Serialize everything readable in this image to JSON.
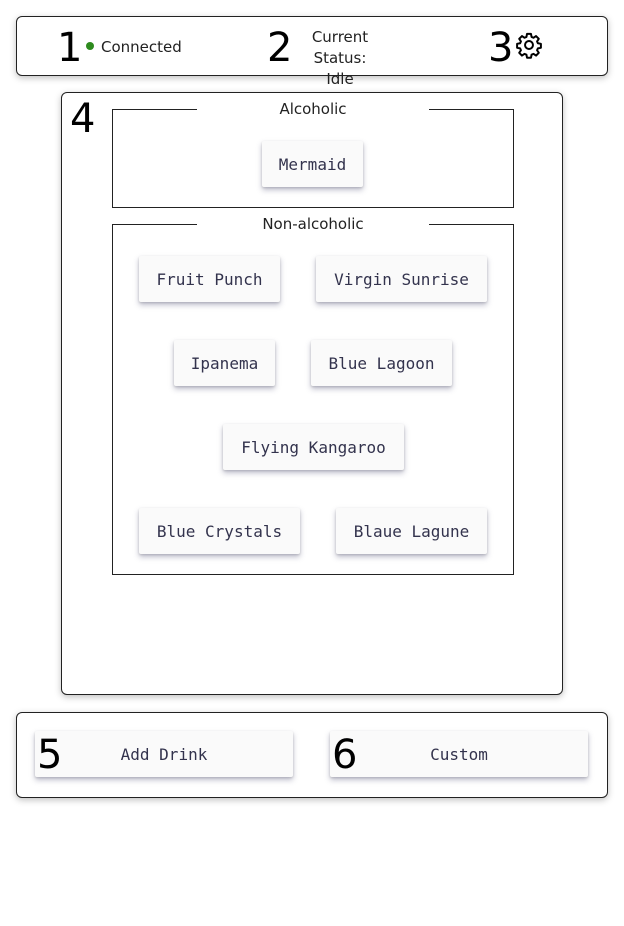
{
  "header": {
    "markers": [
      "1",
      "2",
      "3"
    ],
    "connection_text": "Connected",
    "status_label": "Current Status:",
    "status_value": "Idle",
    "settings_icon": "gear-icon",
    "connection_color": "#2e8b1e"
  },
  "menu": {
    "marker": "4",
    "alcoholic": {
      "legend": "Alcoholic",
      "drinks": [
        "Mermaid"
      ]
    },
    "non_alcoholic": {
      "legend": "Non-alcoholic",
      "drinks": [
        "Fruit Punch",
        "Virgin Sunrise",
        "Ipanema",
        "Blue Lagoon",
        "Flying Kangaroo",
        "Blue Crystals",
        "Blaue Lagune"
      ]
    }
  },
  "footer": {
    "add_drink": {
      "marker": "5",
      "label": "Add Drink"
    },
    "custom": {
      "marker": "6",
      "label": "Custom"
    }
  }
}
